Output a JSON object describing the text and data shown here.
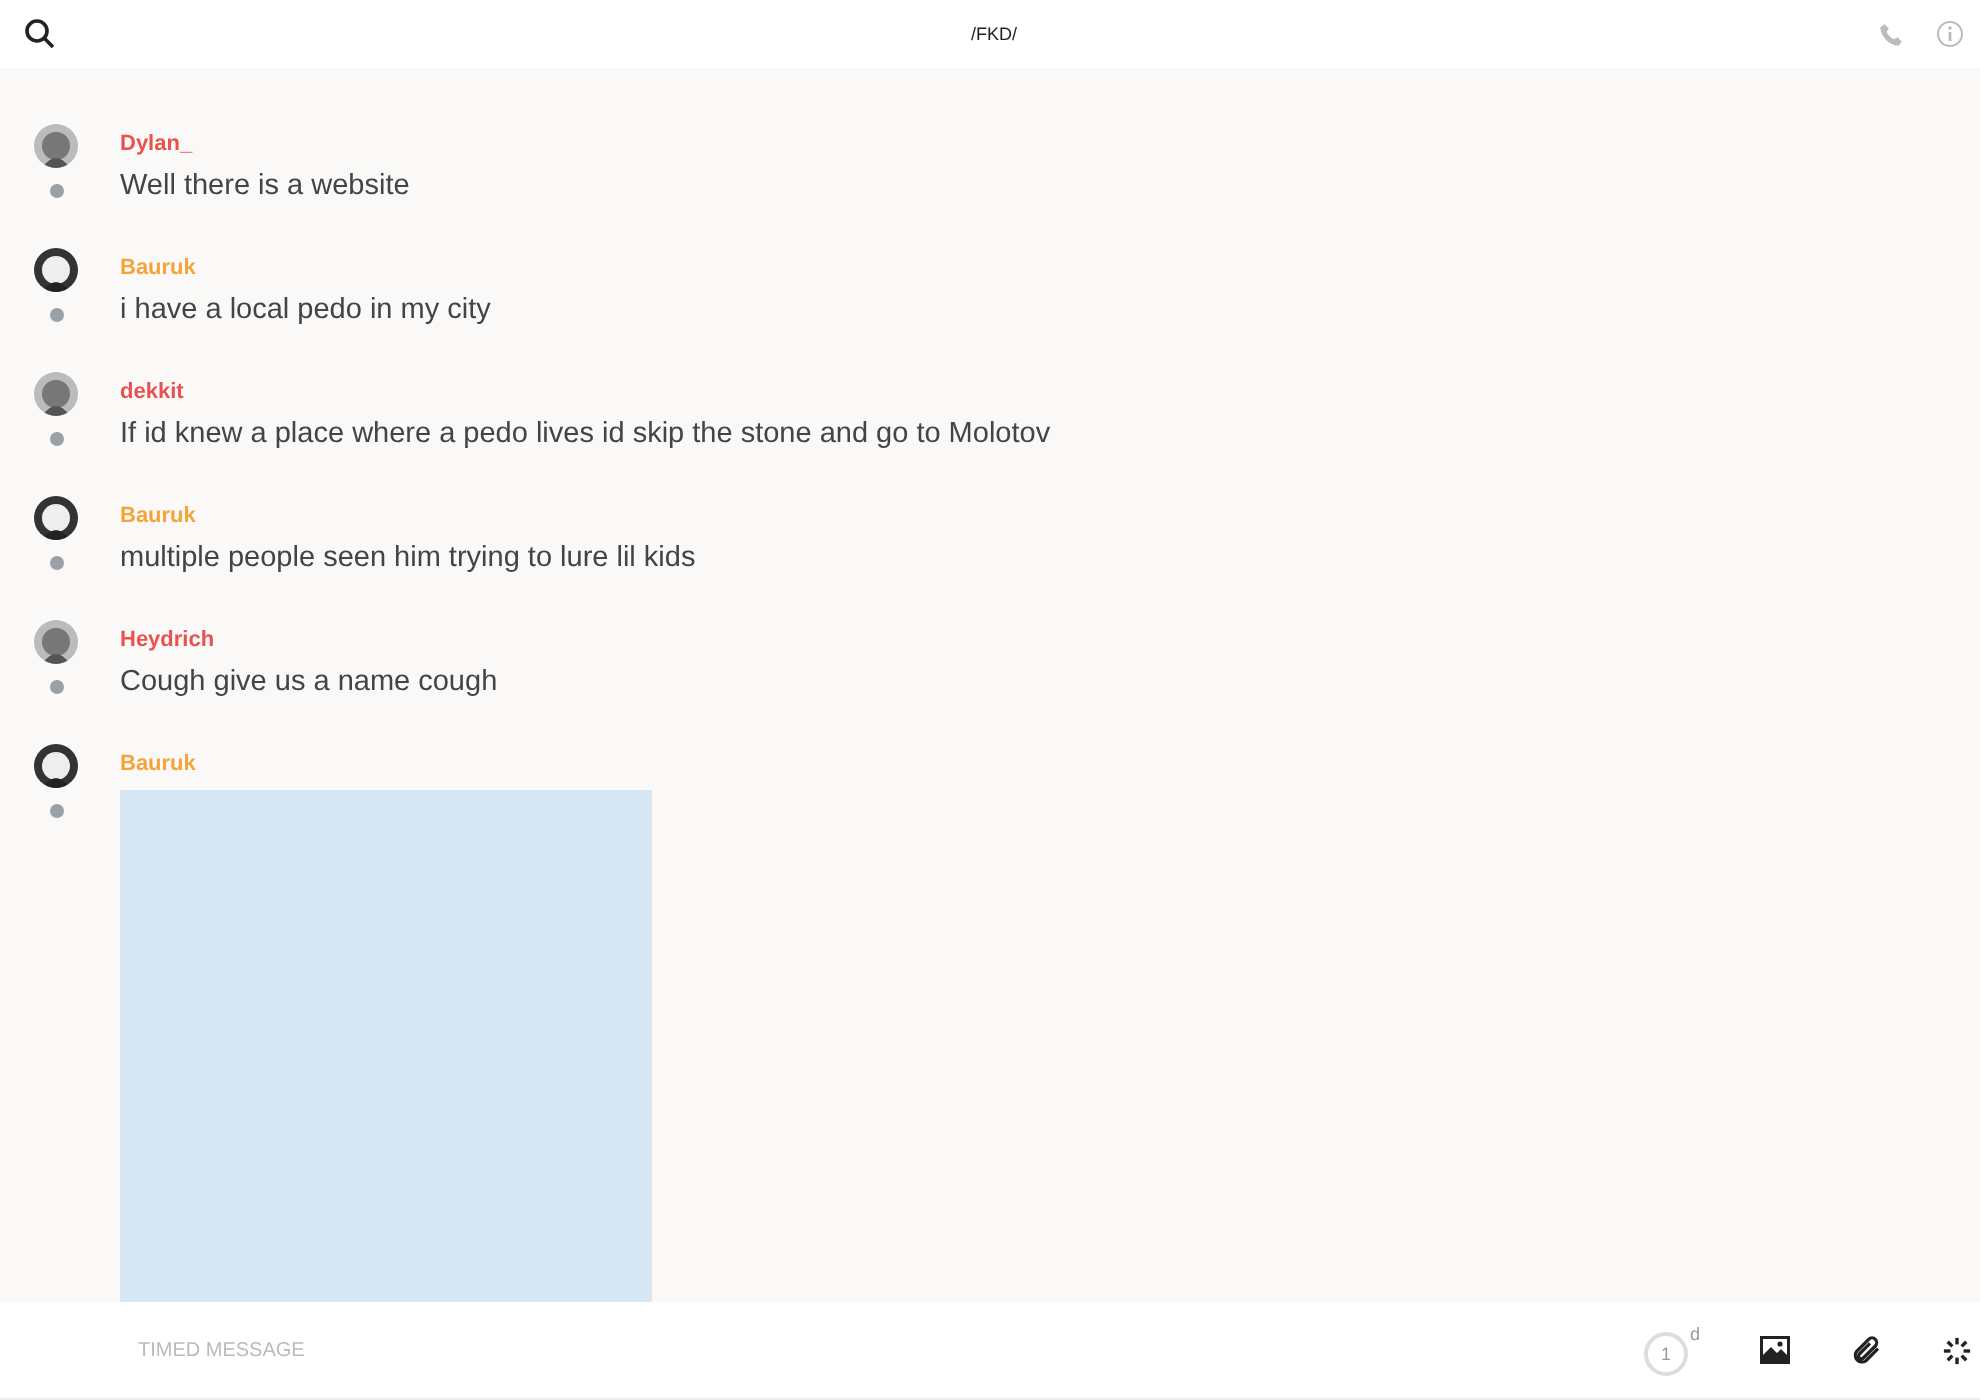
{
  "header": {
    "title": "/FKD/"
  },
  "messages": [
    {
      "author": "Dylan_",
      "color": "#e8534f",
      "text": "Well there is a website"
    },
    {
      "author": "Bauruk",
      "color": "#f3a53c",
      "text": "i have a local pedo in my city"
    },
    {
      "author": "dekkit",
      "color": "#e8534f",
      "text": "If id knew a place where a pedo lives id skip the stone and go to Molotov"
    },
    {
      "author": "Bauruk",
      "color": "#f3a53c",
      "text": "multiple people seen him trying to lure lil kids"
    },
    {
      "author": "Heydrich",
      "color": "#e8534f",
      "text": "Cough give us a name cough"
    },
    {
      "author": "Bauruk",
      "color": "#f3a53c"
    }
  ],
  "composer": {
    "placeholder": "TIMED MESSAGE",
    "timer": {
      "value": "1",
      "unit": "d"
    }
  }
}
